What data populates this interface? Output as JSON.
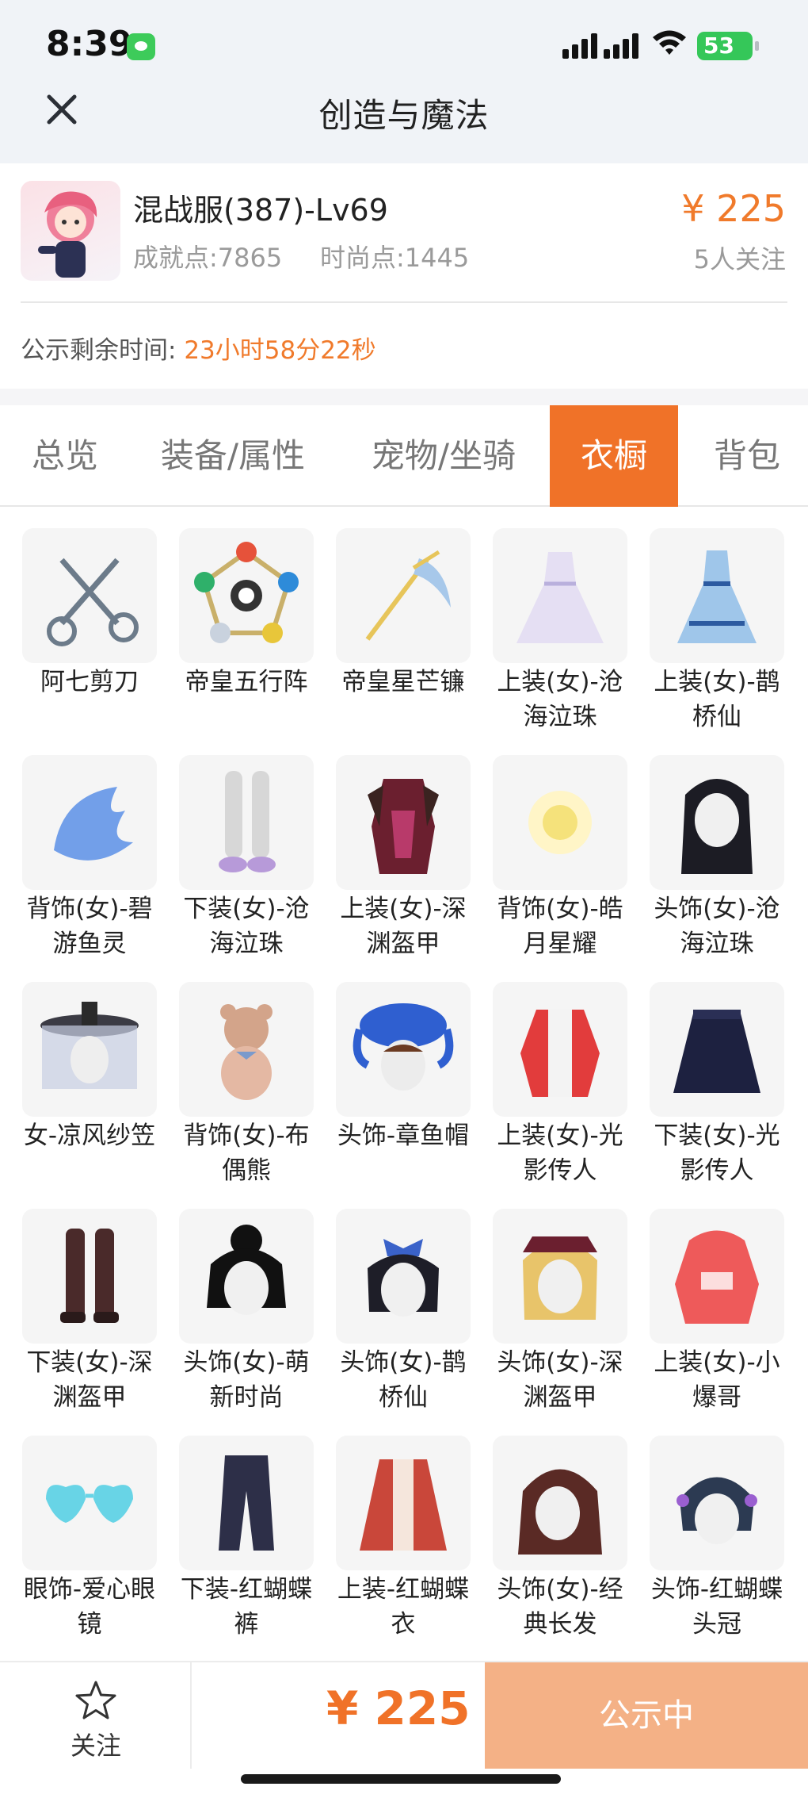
{
  "status": {
    "time": "8:39",
    "battery": "53"
  },
  "header": {
    "title": "创造与魔法"
  },
  "product": {
    "name": "混战服(387)-Lv69",
    "achievement": "成就点:7865",
    "fashion": "时尚点:1445",
    "price": "¥ 225",
    "followers": "5人关注",
    "remaining_label": "公示剩余时间:",
    "remaining_time": "23小时58分22秒"
  },
  "tabs": [
    {
      "label": "总览"
    },
    {
      "label": "装备/属性"
    },
    {
      "label": "宠物/坐骑"
    },
    {
      "label": "衣橱",
      "active": true
    },
    {
      "label": "背包"
    }
  ],
  "items": [
    {
      "label": "阿七剪刀",
      "icon": "scissors-icon"
    },
    {
      "label": "帝皇五行阵",
      "icon": "orb-ring-icon"
    },
    {
      "label": "帝皇星芒镰",
      "icon": "scythe-icon"
    },
    {
      "label": "上装(女)-沧海泣珠",
      "icon": "dress-icon"
    },
    {
      "label": "上装(女)-鹊桥仙",
      "icon": "gown-icon"
    },
    {
      "label": "背饰(女)-碧游鱼灵",
      "icon": "water-wings-icon"
    },
    {
      "label": "下装(女)-沧海泣珠",
      "icon": "legs-icon"
    },
    {
      "label": "上装(女)-深渊盔甲",
      "icon": "armor-icon"
    },
    {
      "label": "背饰(女)-皓月星耀",
      "icon": "glow-orb-icon"
    },
    {
      "label": "头饰(女)-沧海泣珠",
      "icon": "head-long-hair-icon"
    },
    {
      "label": "女-凉风纱笠",
      "icon": "veil-hat-icon"
    },
    {
      "label": "背饰(女)-布偶熊",
      "icon": "teddy-bear-icon"
    },
    {
      "label": "头饰-章鱼帽",
      "icon": "octopus-hat-icon"
    },
    {
      "label": "上装(女)-光影传人",
      "icon": "red-jacket-icon"
    },
    {
      "label": "下装(女)-光影传人",
      "icon": "skirt-icon"
    },
    {
      "label": "下装(女)-深渊盔甲",
      "icon": "boots-icon"
    },
    {
      "label": "头饰(女)-萌新时尚",
      "icon": "head-bun-icon"
    },
    {
      "label": "头饰(女)-鹊桥仙",
      "icon": "head-bow-icon"
    },
    {
      "label": "头饰(女)-深渊盔甲",
      "icon": "head-blonde-icon"
    },
    {
      "label": "上装(女)-小爆哥",
      "icon": "hoodie-icon"
    },
    {
      "label": "眼饰-爱心眼镜",
      "icon": "heart-glasses-icon"
    },
    {
      "label": "下装-红蝴蝶裤",
      "icon": "pants-icon"
    },
    {
      "label": "上装-红蝴蝶衣",
      "icon": "red-coat-icon"
    },
    {
      "label": "头饰(女)-经典长发",
      "icon": "head-brown-hair-icon"
    },
    {
      "label": "头饰-红蝴蝶头冠",
      "icon": "head-crown-icon"
    }
  ],
  "bottom": {
    "follow_label": "关注",
    "price": "¥ 225",
    "action_label": "公示中"
  },
  "colors": {
    "accent": "#f07228",
    "action_disabled": "#f4b186"
  }
}
